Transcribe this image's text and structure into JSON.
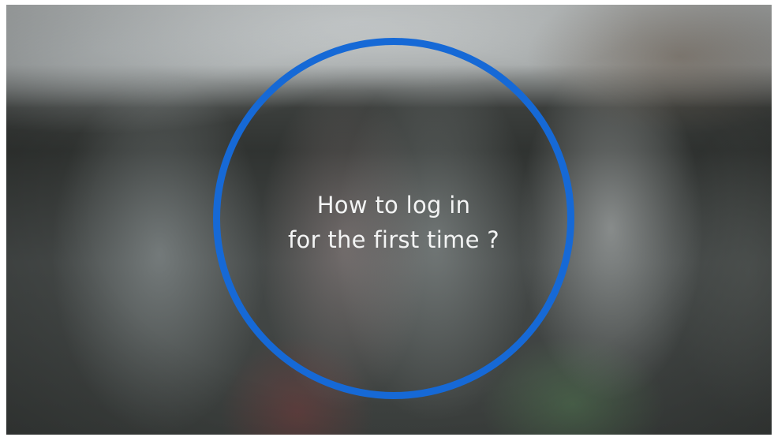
{
  "title_card": {
    "line1": "How to log in",
    "line2": "for the first time ?"
  },
  "colors": {
    "ring": "#1669d6",
    "text": "#f3f4f4"
  }
}
